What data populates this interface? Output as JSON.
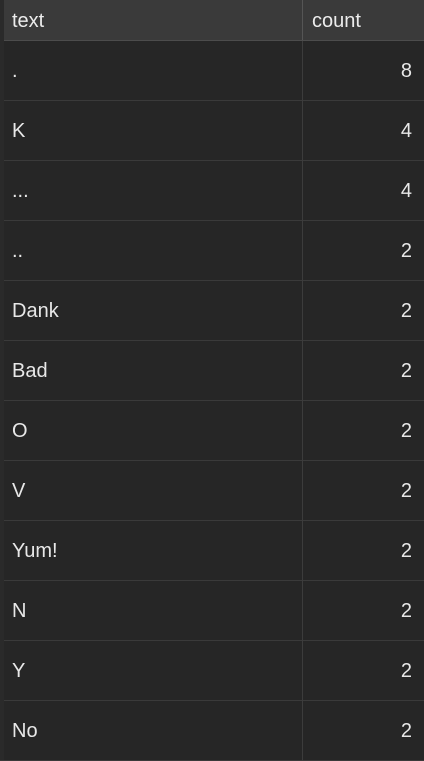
{
  "table": {
    "columns": [
      "text",
      "count"
    ],
    "rows": [
      {
        "text": ".",
        "count": "8"
      },
      {
        "text": "K",
        "count": "4"
      },
      {
        "text": "...",
        "count": "4"
      },
      {
        "text": "..",
        "count": "2"
      },
      {
        "text": "Dank",
        "count": "2"
      },
      {
        "text": "Bad",
        "count": "2"
      },
      {
        "text": "O",
        "count": "2"
      },
      {
        "text": "V",
        "count": "2"
      },
      {
        "text": "Yum!",
        "count": "2"
      },
      {
        "text": "N",
        "count": "2"
      },
      {
        "text": "Y",
        "count": "2"
      },
      {
        "text": "No",
        "count": "2"
      }
    ]
  },
  "colors": {
    "background": "#1e1e1e",
    "header_bg": "#3a3a3a",
    "row_bg": "#262626",
    "text": "#e8e8e8"
  }
}
